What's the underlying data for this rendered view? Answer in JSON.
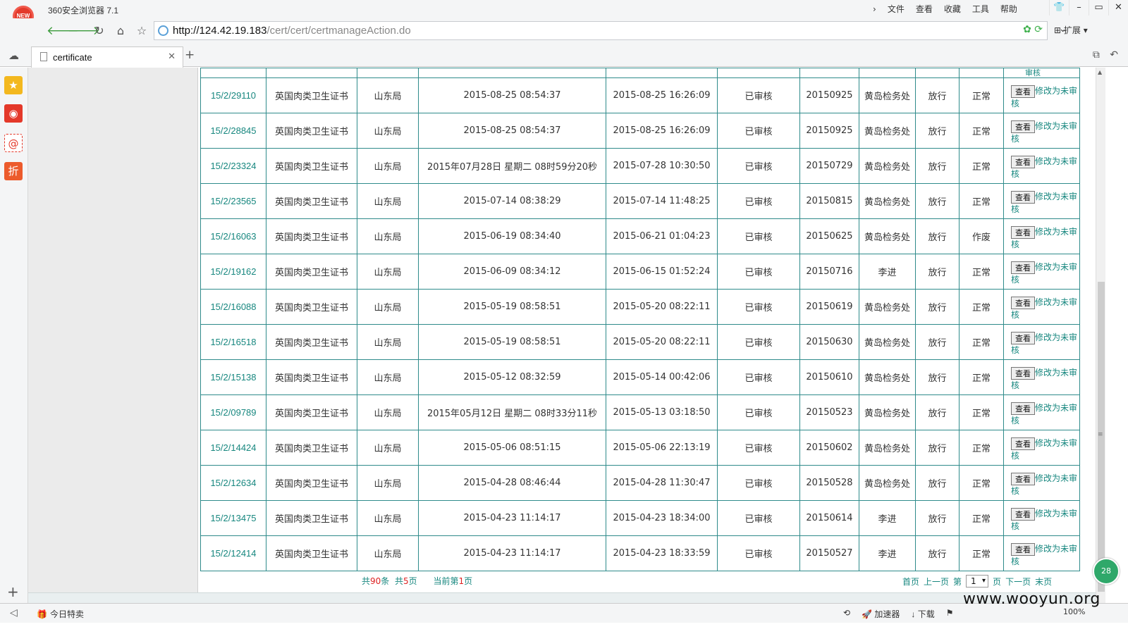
{
  "browser": {
    "logo_text": "NEW",
    "title": "360安全浏览器 7.1",
    "menu": [
      "文件",
      "查看",
      "收藏",
      "工具",
      "帮助"
    ],
    "url_host": "http://124.42.19.183",
    "url_path": "/cert/cert/certmanageAction.do",
    "extensions_label": "扩展",
    "tab_title": "certificate"
  },
  "sidebar_icons": [
    "star-icon",
    "weibo-icon",
    "email-icon",
    "discount-icon"
  ],
  "sidebar_discount_text": "折",
  "table": {
    "partial_row_ops": "审核",
    "rows": [
      {
        "id": "15/2/29110",
        "type": "英国肉类卫生证书",
        "bureau": "山东局",
        "time1": "2015-08-25 08:54:37",
        "time2": "2015-08-25 16:26:09",
        "status": "已审核",
        "date": "20150925",
        "office": "黄岛检务处",
        "result": "放行",
        "state": "正常"
      },
      {
        "id": "15/2/28845",
        "type": "英国肉类卫生证书",
        "bureau": "山东局",
        "time1": "2015-08-25 08:54:37",
        "time2": "2015-08-25 16:26:09",
        "status": "已审核",
        "date": "20150925",
        "office": "黄岛检务处",
        "result": "放行",
        "state": "正常"
      },
      {
        "id": "15/2/23324",
        "type": "英国肉类卫生证书",
        "bureau": "山东局",
        "time1": "2015年07月28日 星期二 08时59分20秒",
        "time2": "2015-07-28 10:30:50",
        "status": "已审核",
        "date": "20150729",
        "office": "黄岛检务处",
        "result": "放行",
        "state": "正常"
      },
      {
        "id": "15/2/23565",
        "type": "英国肉类卫生证书",
        "bureau": "山东局",
        "time1": "2015-07-14 08:38:29",
        "time2": "2015-07-14 11:48:25",
        "status": "已审核",
        "date": "20150815",
        "office": "黄岛检务处",
        "result": "放行",
        "state": "正常"
      },
      {
        "id": "15/2/16063",
        "type": "英国肉类卫生证书",
        "bureau": "山东局",
        "time1": "2015-06-19 08:34:40",
        "time2": "2015-06-21 01:04:23",
        "status": "已审核",
        "date": "20150625",
        "office": "黄岛检务处",
        "result": "放行",
        "state": "作废"
      },
      {
        "id": "15/2/19162",
        "type": "英国肉类卫生证书",
        "bureau": "山东局",
        "time1": "2015-06-09 08:34:12",
        "time2": "2015-06-15 01:52:24",
        "status": "已审核",
        "date": "20150716",
        "office": "李进",
        "result": "放行",
        "state": "正常"
      },
      {
        "id": "15/2/16088",
        "type": "英国肉类卫生证书",
        "bureau": "山东局",
        "time1": "2015-05-19 08:58:51",
        "time2": "2015-05-20 08:22:11",
        "status": "已审核",
        "date": "20150619",
        "office": "黄岛检务处",
        "result": "放行",
        "state": "正常"
      },
      {
        "id": "15/2/16518",
        "type": "英国肉类卫生证书",
        "bureau": "山东局",
        "time1": "2015-05-19 08:58:51",
        "time2": "2015-05-20 08:22:11",
        "status": "已审核",
        "date": "20150630",
        "office": "黄岛检务处",
        "result": "放行",
        "state": "正常"
      },
      {
        "id": "15/2/15138",
        "type": "英国肉类卫生证书",
        "bureau": "山东局",
        "time1": "2015-05-12 08:32:59",
        "time2": "2015-05-14 00:42:06",
        "status": "已审核",
        "date": "20150610",
        "office": "黄岛检务处",
        "result": "放行",
        "state": "正常"
      },
      {
        "id": "15/2/09789",
        "type": "英国肉类卫生证书",
        "bureau": "山东局",
        "time1": "2015年05月12日 星期二 08时33分11秒",
        "time2": "2015-05-13 03:18:50",
        "status": "已审核",
        "date": "20150523",
        "office": "黄岛检务处",
        "result": "放行",
        "state": "正常"
      },
      {
        "id": "15/2/14424",
        "type": "英国肉类卫生证书",
        "bureau": "山东局",
        "time1": "2015-05-06 08:51:15",
        "time2": "2015-05-06 22:13:19",
        "status": "已审核",
        "date": "20150602",
        "office": "黄岛检务处",
        "result": "放行",
        "state": "正常"
      },
      {
        "id": "15/2/12634",
        "type": "英国肉类卫生证书",
        "bureau": "山东局",
        "time1": "2015-04-28 08:46:44",
        "time2": "2015-04-28 11:30:47",
        "status": "已审核",
        "date": "20150528",
        "office": "黄岛检务处",
        "result": "放行",
        "state": "正常"
      },
      {
        "id": "15/2/13475",
        "type": "英国肉类卫生证书",
        "bureau": "山东局",
        "time1": "2015-04-23 11:14:17",
        "time2": "2015-04-23 18:34:00",
        "status": "已审核",
        "date": "20150614",
        "office": "李进",
        "result": "放行",
        "state": "正常"
      },
      {
        "id": "15/2/12414",
        "type": "英国肉类卫生证书",
        "bureau": "山东局",
        "time1": "2015-04-23 11:14:17",
        "time2": "2015-04-23 18:33:59",
        "status": "已审核",
        "date": "20150527",
        "office": "李进",
        "result": "放行",
        "state": "正常"
      }
    ],
    "view_button": "查看",
    "modify_link": "修改为未审核"
  },
  "pager": {
    "total_prefix": "共",
    "total_records": "90",
    "total_records_suffix": "条",
    "pages_prefix": "共",
    "total_pages": "5",
    "pages_suffix": "页",
    "current_prefix": "当前第",
    "current_page": "1",
    "current_suffix": "页",
    "first": "首页",
    "prev": "上一页",
    "goto_prefix": "第",
    "goto_value": "1",
    "goto_suffix": "页",
    "next": "下一页",
    "last": "末页"
  },
  "statusbar": {
    "deal": "今日特卖",
    "accelerator": "加速器",
    "download": "下载",
    "zoom": "100%"
  },
  "floating_badge": "28",
  "watermark": "www.wooyun.org"
}
